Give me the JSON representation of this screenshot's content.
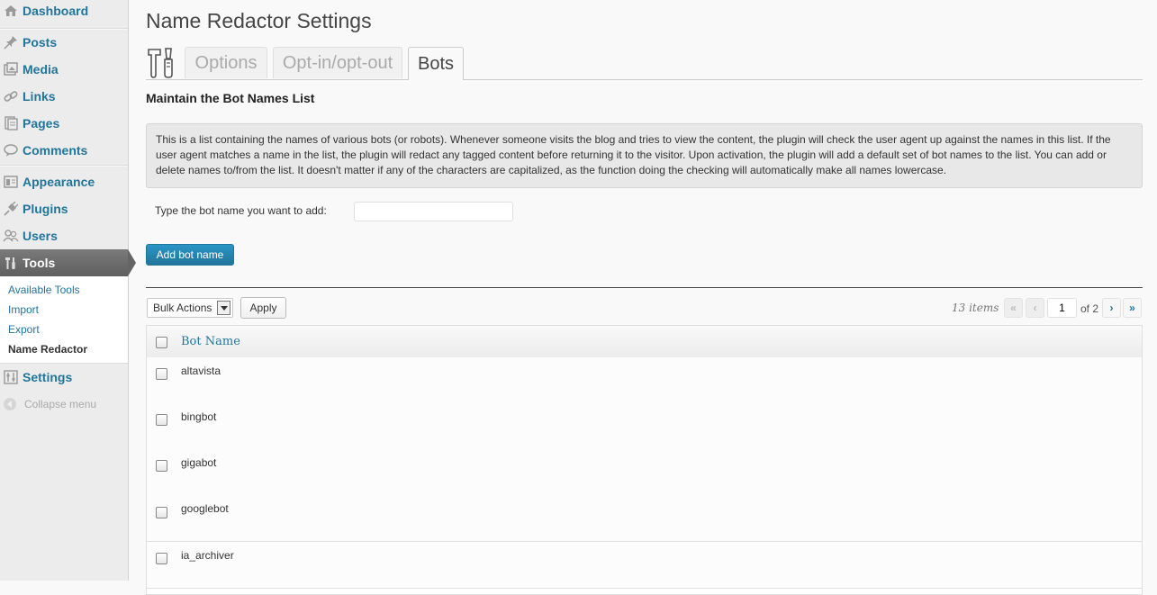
{
  "sidebar": {
    "items": [
      {
        "label": "Dashboard",
        "icon": "dashboard-icon"
      },
      {
        "label": "Posts",
        "icon": "pin-icon"
      },
      {
        "label": "Media",
        "icon": "media-icon"
      },
      {
        "label": "Links",
        "icon": "link-icon"
      },
      {
        "label": "Pages",
        "icon": "pages-icon"
      },
      {
        "label": "Comments",
        "icon": "comment-icon"
      },
      {
        "label": "Appearance",
        "icon": "appearance-icon"
      },
      {
        "label": "Plugins",
        "icon": "plug-icon"
      },
      {
        "label": "Users",
        "icon": "users-icon"
      },
      {
        "label": "Tools",
        "icon": "tools-icon"
      },
      {
        "label": "Settings",
        "icon": "settings-icon"
      }
    ],
    "submenu": [
      {
        "label": "Available Tools"
      },
      {
        "label": "Import"
      },
      {
        "label": "Export"
      },
      {
        "label": "Name Redactor"
      }
    ],
    "collapse_label": "Collapse menu"
  },
  "page": {
    "title": "Name Redactor Settings",
    "tabs": [
      {
        "label": "Options"
      },
      {
        "label": "Opt-in/opt-out"
      },
      {
        "label": "Bots"
      }
    ],
    "active_tab": "Bots",
    "section_heading": "Maintain the Bot Names List",
    "description": "This is a list containing the names of various bots (or robots). Whenever someone visits the blog and tries to view the content, the plugin will check the user agent up against the names in this list. If the user agent matches a name in the list, the plugin will redact any tagged content before returning it to the visitor. Upon activation, the plugin will add a default set of bot names to the list. You can add or delete names to/from the list. It doesn't matter if any of the characters are capitalized, as the function doing the checking will automatically make all names lowercase.",
    "add_label": "Type the bot name you want to add:",
    "add_input_value": "",
    "add_button": "Add bot name"
  },
  "list": {
    "bulk_actions": "Bulk Actions",
    "apply": "Apply",
    "items_count": "13 items",
    "pagination": {
      "first": "«",
      "prev": "‹",
      "current_page": "1",
      "of_pages": "of 2",
      "next": "›",
      "last": "»"
    },
    "column_header": "Bot Name",
    "rows": [
      "altavista",
      "bingbot",
      "gigabot",
      "googlebot",
      "ia_archiver"
    ]
  },
  "colors": {
    "link": "#21759b",
    "primary_button": "#21759b",
    "active_menu": "#6d6d6d"
  }
}
